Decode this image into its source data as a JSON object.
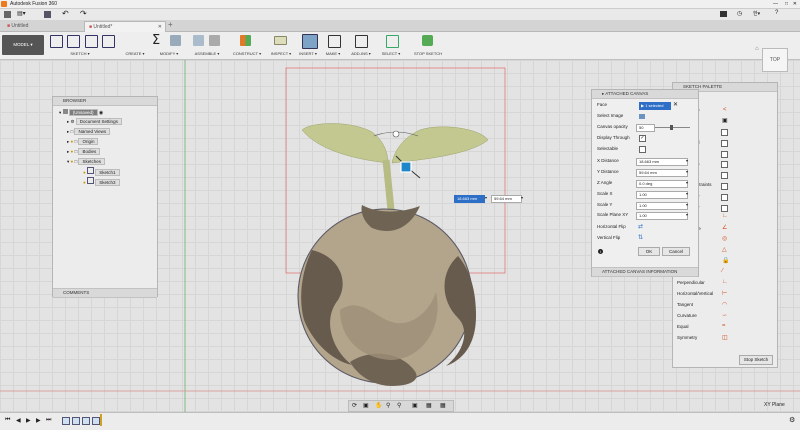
{
  "window": {
    "title": "Autodesk Fusion 360"
  },
  "quick_access": {
    "undo_label": "",
    "user": "",
    "help": "?"
  },
  "tabs": [
    {
      "label": "Untitled"
    },
    {
      "label": "Untitled*"
    }
  ],
  "ribbon": {
    "workspace": "MODEL",
    "groups": [
      "SKETCH",
      "CREATE",
      "MODIFY",
      "ASSEMBLE",
      "CONSTRUCT",
      "INSPECT",
      "INSERT",
      "MAKE",
      "ADD-INS",
      "SELECT",
      "STOP SKETCH"
    ]
  },
  "viewcube": {
    "label": "TOP"
  },
  "browser": {
    "title": "BROWSER",
    "root": "(Unsaved)",
    "items": [
      {
        "label": "Document Settings"
      },
      {
        "label": "Named Views"
      },
      {
        "label": "Origin"
      },
      {
        "label": "Bodies"
      },
      {
        "label": "Sketches"
      },
      {
        "label": "Sketch1"
      },
      {
        "label": "Sketch3"
      }
    ],
    "comments": "COMMENTS"
  },
  "inline_dims": {
    "x": "18.663 mm",
    "y": "59.64 mm"
  },
  "attached_canvas": {
    "title": "ATTACHED CANVAS",
    "face_label": "Face",
    "face_value": "1 selected",
    "select_image": "Select Image",
    "canvas_opacity": "Canvas opacity",
    "opacity_value": "50",
    "display_through": "Display Through",
    "selectable": "Selectable",
    "x_distance": "X Distance",
    "x_value": "18.663 mm",
    "y_distance": "Y Distance",
    "y_value": "59.64 mm",
    "z_angle": "Z Angle",
    "z_value": "0.0 deg",
    "scale_x": "Scale X",
    "scale_x_value": "1.00",
    "scale_y": "Scale Y",
    "scale_y_value": "1.00",
    "scale_xy": "Scale Plane XY",
    "scale_xy_value": "1.00",
    "hflip": "Horizontal Flip",
    "vflip": "Vertical Flip",
    "ok": "OK",
    "cancel": "Cancel",
    "info": "ATTACHED CANVAS INFORMATION"
  },
  "sketch_palette": {
    "title": "SKETCH PALETTE",
    "partial_labels": [
      "n",
      "s",
      "d",
      "a",
      "c",
      "straints",
      "e",
      "e",
      "te"
    ],
    "constraints": [
      "Perpendicular",
      "Horizontal/Vertical",
      "Tangent",
      "Curvature",
      "Equal",
      "Symmetry"
    ],
    "stop_sketch": "Stop Sketch"
  },
  "plane_label": "XY Plane"
}
